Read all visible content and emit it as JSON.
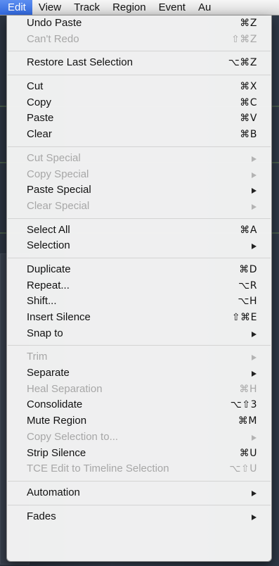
{
  "menubar": {
    "items": [
      "Edit",
      "View",
      "Track",
      "Region",
      "Event",
      "Au"
    ],
    "active_index": 0
  },
  "edit_menu": {
    "groups": [
      [
        {
          "label": "Undo Paste",
          "shortcut": "⌘Z",
          "enabled": true
        },
        {
          "label": "Can't Redo",
          "shortcut": "⇧⌘Z",
          "enabled": false
        }
      ],
      [
        {
          "label": "Restore Last Selection",
          "shortcut": "⌥⌘Z",
          "enabled": true
        }
      ],
      [
        {
          "label": "Cut",
          "shortcut": "⌘X",
          "enabled": true
        },
        {
          "label": "Copy",
          "shortcut": "⌘C",
          "enabled": true
        },
        {
          "label": "Paste",
          "shortcut": "⌘V",
          "enabled": true
        },
        {
          "label": "Clear",
          "shortcut": "⌘B",
          "enabled": true
        }
      ],
      [
        {
          "label": "Cut Special",
          "submenu": true,
          "enabled": false
        },
        {
          "label": "Copy Special",
          "submenu": true,
          "enabled": false
        },
        {
          "label": "Paste Special",
          "submenu": true,
          "enabled": true
        },
        {
          "label": "Clear Special",
          "submenu": true,
          "enabled": false
        }
      ],
      [
        {
          "label": "Select All",
          "shortcut": "⌘A",
          "enabled": true
        },
        {
          "label": "Selection",
          "submenu": true,
          "enabled": true
        }
      ],
      [
        {
          "label": "Duplicate",
          "shortcut": "⌘D",
          "enabled": true
        },
        {
          "label": "Repeat...",
          "shortcut": "⌥R",
          "enabled": true
        },
        {
          "label": "Shift...",
          "shortcut": "⌥H",
          "enabled": true
        },
        {
          "label": "Insert Silence",
          "shortcut": "⇧⌘E",
          "enabled": true
        },
        {
          "label": "Snap to",
          "submenu": true,
          "enabled": true
        }
      ],
      [
        {
          "label": "Trim",
          "submenu": true,
          "enabled": false
        },
        {
          "label": "Separate",
          "submenu": true,
          "enabled": true
        },
        {
          "label": "Heal Separation",
          "shortcut": "⌘H",
          "enabled": false
        },
        {
          "label": "Consolidate",
          "shortcut": "⌥⇧3",
          "enabled": true
        },
        {
          "label": "Mute Region",
          "shortcut": "⌘M",
          "enabled": true
        },
        {
          "label": "Copy Selection to...",
          "submenu": true,
          "enabled": false
        },
        {
          "label": "Strip Silence",
          "shortcut": "⌘U",
          "enabled": true
        },
        {
          "label": "TCE Edit to Timeline Selection",
          "shortcut": "⌥⇧U",
          "enabled": false
        }
      ],
      [
        {
          "label": "Automation",
          "submenu": true,
          "enabled": true
        }
      ],
      [
        {
          "label": "Fades",
          "submenu": true,
          "enabled": true
        }
      ]
    ]
  },
  "colors": {
    "menubar_highlight": "#3a72e6",
    "disabled_text": "#a7a7a7",
    "menu_background": "#f6f6f6"
  }
}
